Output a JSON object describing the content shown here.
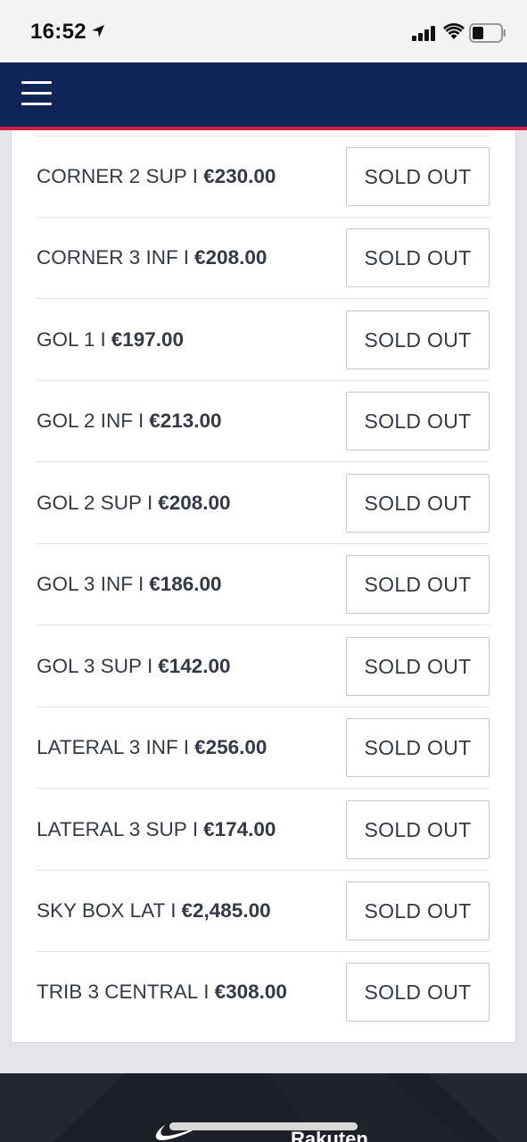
{
  "status_bar": {
    "time": "16:52"
  },
  "nav": {
    "menu_icon": "hamburger-menu-icon"
  },
  "tickets": [
    {
      "name": "CORNER 2 SUP",
      "separator": "I",
      "price": "€230.00",
      "status": "SOLD OUT"
    },
    {
      "name": "CORNER 3 INF",
      "separator": "I",
      "price": "€208.00",
      "status": "SOLD OUT"
    },
    {
      "name": "GOL 1",
      "separator": "I",
      "price": "€197.00",
      "status": "SOLD OUT"
    },
    {
      "name": "GOL 2 INF",
      "separator": "I",
      "price": "€213.00",
      "status": "SOLD OUT"
    },
    {
      "name": "GOL 2 SUP",
      "separator": "I",
      "price": "€208.00",
      "status": "SOLD OUT"
    },
    {
      "name": "GOL 3 INF",
      "separator": "I",
      "price": "€186.00",
      "status": "SOLD OUT"
    },
    {
      "name": "GOL 3 SUP",
      "separator": "I",
      "price": "€142.00",
      "status": "SOLD OUT"
    },
    {
      "name": "LATERAL 3 INF",
      "separator": "I",
      "price": "€256.00",
      "status": "SOLD OUT"
    },
    {
      "name": "LATERAL 3 SUP",
      "separator": "I",
      "price": "€174.00",
      "status": "SOLD OUT"
    },
    {
      "name": "SKY BOX LAT",
      "separator": "I",
      "price": "€2,485.00",
      "status": "SOLD OUT"
    },
    {
      "name": "TRIB 3 CENTRAL",
      "separator": "I",
      "price": "€308.00",
      "status": "SOLD OUT"
    }
  ],
  "footer": {
    "sponsor_logo_text": "Rakuten",
    "swoosh_icon": "swoosh-logo-icon"
  },
  "colors": {
    "nav_background": "#0f2457",
    "nav_accent": "#d01f3c",
    "text": "#333a44",
    "page_background": "#e4e5e9"
  }
}
